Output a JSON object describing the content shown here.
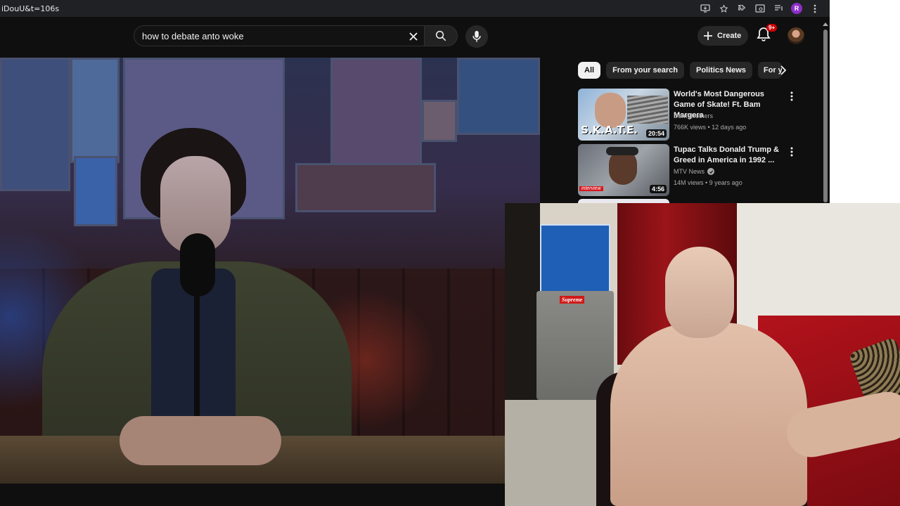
{
  "browser": {
    "url_fragment": "iDouU&t=106s",
    "profile_initial": "R"
  },
  "header": {
    "search_query": "how to debate anto woke",
    "create_label": "Create",
    "notifications_badge": "9+"
  },
  "chips": [
    {
      "label": "All",
      "active": true
    },
    {
      "label": "From your search",
      "active": false
    },
    {
      "label": "Politics News",
      "active": false
    },
    {
      "label": "For y",
      "active": false
    }
  ],
  "recommendations": [
    {
      "title": "World's Most Dangerous Game of Skate! Ft. Bam Margera",
      "channel": "Dern Brothers",
      "verified": false,
      "meta": "766K views • 12 days ago",
      "duration": "20:54",
      "thumb_text": "S.K.A.T.E."
    },
    {
      "title": "Tupac Talks Donald Trump & Greed in America in 1992 ...",
      "channel": "MTV News",
      "verified": true,
      "meta": "14M views • 9 years ago",
      "duration": "4:56",
      "thumb_text": "interview"
    }
  ],
  "webcam": {
    "sign_text": "Supreme"
  },
  "icons": [
    "cast-icon",
    "star-icon",
    "extensions-icon",
    "tab-search-icon",
    "media-icon",
    "kebab-icon",
    "close-icon",
    "search-icon",
    "mic-icon",
    "plus-icon",
    "bell-icon",
    "chevron-right-icon",
    "verified-icon"
  ]
}
